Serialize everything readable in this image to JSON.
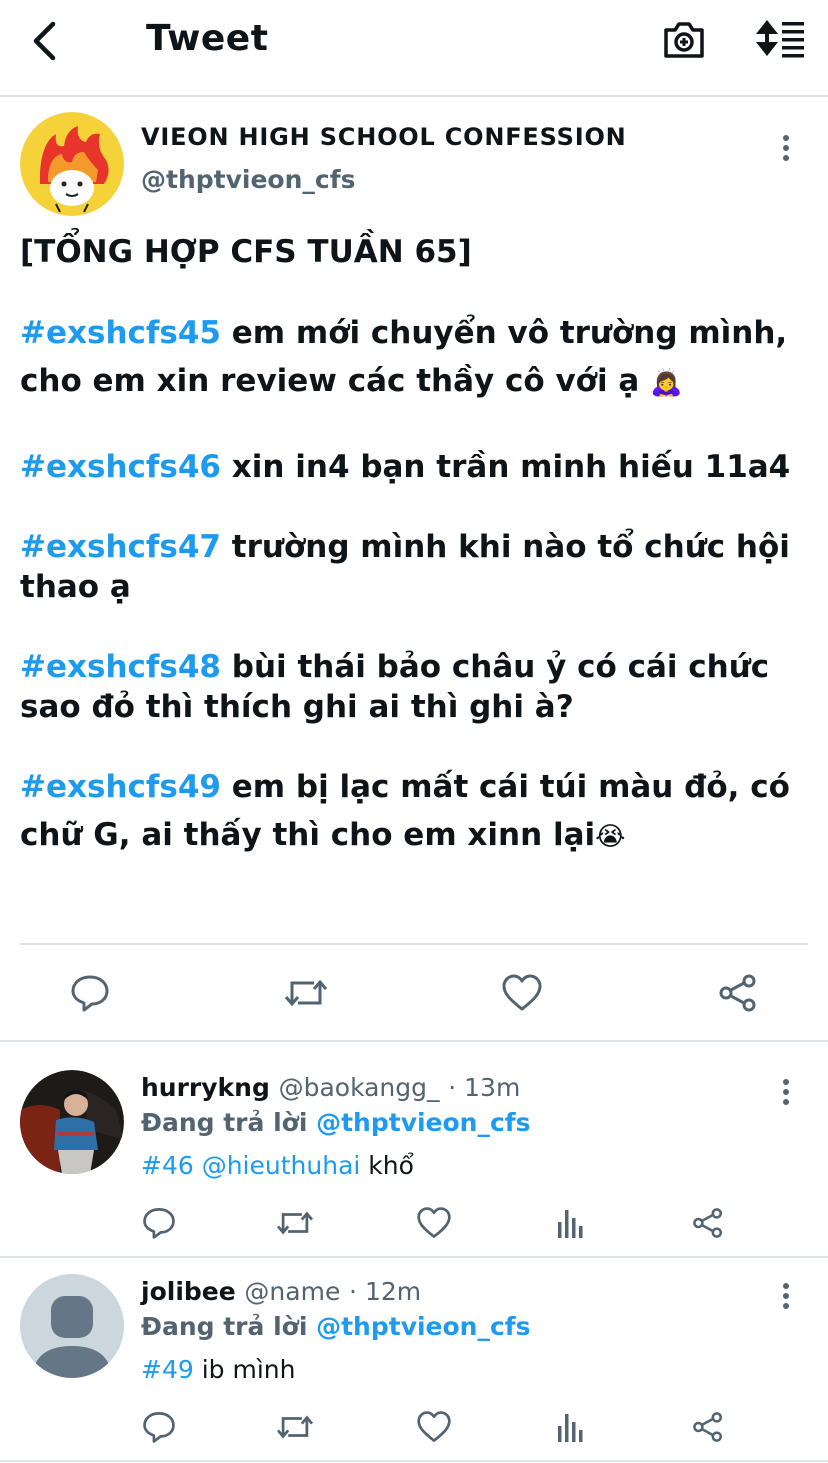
{
  "header": {
    "title": "Tweet"
  },
  "tweet": {
    "author_name": "VIEON HIGH SCHOOL CONFESSION",
    "author_handle": "@thptvieon_cfs",
    "heading": "[TỔNG HỢP CFS TUẦN 65]",
    "items": [
      {
        "tag": "#exshcfs45",
        "line1": " em mới chuyển vô trường mình,",
        "line2": "cho em xin review các thầy cô với ạ ",
        "emoji": "🙇‍♀️"
      },
      {
        "tag": "#exshcfs46",
        "line1": " xin in4 bạn trần minh hiếu 11a4"
      },
      {
        "tag": "#exshcfs47",
        "line1": " trường mình khi nào tổ chức hội",
        "line2": "thao ạ"
      },
      {
        "tag": "#exshcfs48",
        "line1": " bùi thái bảo châu ỷ có cái chức",
        "line2": "sao đỏ thì thích ghi ai thì ghi à?"
      },
      {
        "tag": "#exshcfs49",
        "line1": " em bị lạc mất cái túi màu đỏ, có",
        "line2": "chữ G, ai thấy thì cho em xinn lại",
        "emoji": "😭"
      }
    ]
  },
  "replies": [
    {
      "name": "hurrykng",
      "handle": "@baokangg_",
      "time": "· 13m",
      "replying_prefix": "Đang trả lời ",
      "replying_to": "@thptvieon_cfs",
      "body_tag": "#46",
      "body_mention": " @hieuthuhai",
      "body_text": " khổ"
    },
    {
      "name": "jolibee",
      "handle": "@name",
      "time": "· 12m",
      "replying_prefix": "Đang trả lời ",
      "replying_to": "@thptvieon_cfs",
      "body_tag": "#49",
      "body_text": " ib mình"
    }
  ],
  "colors": {
    "link": "#1d9bf0",
    "muted": "#536471",
    "divider": "#e1e4e6",
    "text": "#0f1419"
  },
  "icons": {
    "back": "chevron-left-icon",
    "camera": "camera-plus-icon",
    "sort": "sort-toggle-icon",
    "reply": "reply-bubble-icon",
    "retweet": "retweet-icon",
    "like": "heart-icon",
    "share": "share-icon",
    "analytics": "analytics-bars-icon",
    "more": "more-vertical-icon"
  }
}
